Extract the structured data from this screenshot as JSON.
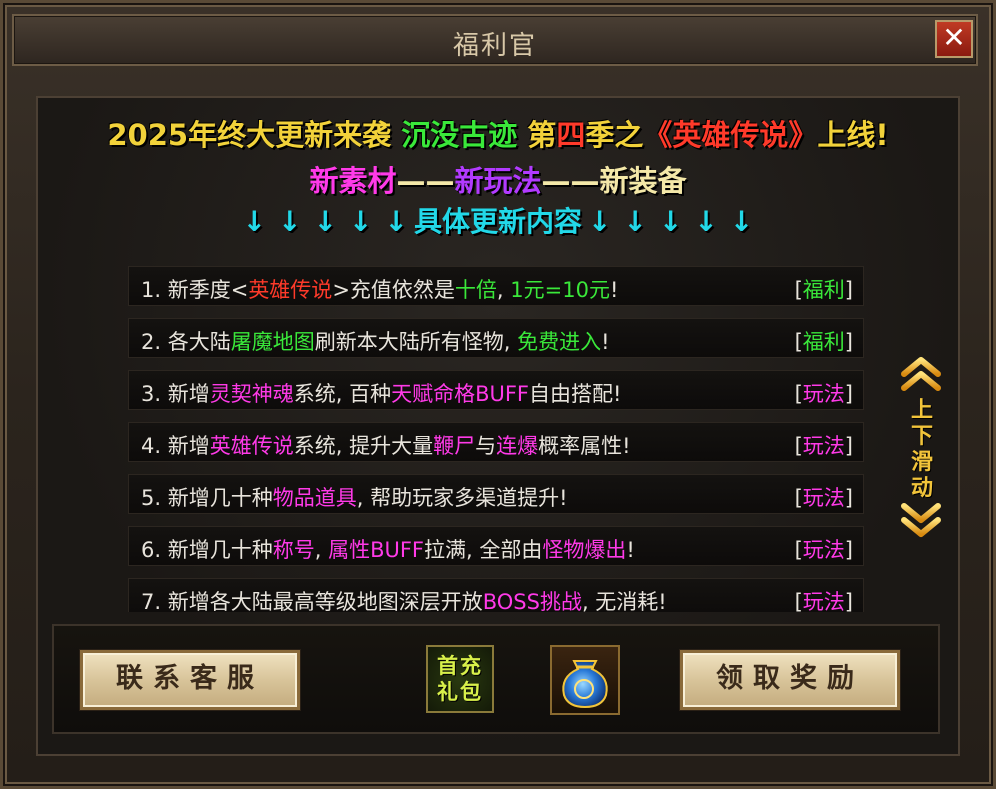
{
  "window": {
    "title": "福利官",
    "close_label": "✕"
  },
  "headline": {
    "part1": "2025年终大更新来袭",
    "part2": "沉没古迹",
    "part3": "第",
    "part4": "四",
    "part5": "季之",
    "part6": "《英雄传说》",
    "part7": "上线!"
  },
  "subline": {
    "item1": "新素材",
    "dash1": "——",
    "item2": "新玩法",
    "dash2": "——",
    "item3": "新装备"
  },
  "details_header": {
    "arrow": "↓",
    "label": "具体更新内容"
  },
  "updates": [
    {
      "segments": [
        {
          "text": "1. 新季度<",
          "color": "white"
        },
        {
          "text": "英雄传说",
          "color": "red"
        },
        {
          "text": ">充值依然是",
          "color": "white"
        },
        {
          "text": "十倍",
          "color": "green"
        },
        {
          "text": ", ",
          "color": "white"
        },
        {
          "text": "1元=10元",
          "color": "green"
        },
        {
          "text": "!",
          "color": "white"
        }
      ],
      "tag": "福利",
      "tag_color": "green"
    },
    {
      "segments": [
        {
          "text": "2. 各大陆",
          "color": "white"
        },
        {
          "text": "屠魔地图",
          "color": "green"
        },
        {
          "text": "刷新本大陆所有怪物, ",
          "color": "white"
        },
        {
          "text": "免费进入",
          "color": "green"
        },
        {
          "text": "!",
          "color": "white"
        }
      ],
      "tag": "福利",
      "tag_color": "green"
    },
    {
      "segments": [
        {
          "text": "3. 新增",
          "color": "white"
        },
        {
          "text": "灵契神魂",
          "color": "magenta"
        },
        {
          "text": "系统, 百种",
          "color": "white"
        },
        {
          "text": "天赋命格BUFF",
          "color": "magenta"
        },
        {
          "text": "自由搭配!",
          "color": "white"
        }
      ],
      "tag": "玩法",
      "tag_color": "magenta"
    },
    {
      "segments": [
        {
          "text": "4. 新增",
          "color": "white"
        },
        {
          "text": "英雄传说",
          "color": "magenta"
        },
        {
          "text": "系统, 提升大量",
          "color": "white"
        },
        {
          "text": "鞭尸",
          "color": "magenta"
        },
        {
          "text": "与",
          "color": "white"
        },
        {
          "text": "连爆",
          "color": "magenta"
        },
        {
          "text": "概率属性!",
          "color": "white"
        }
      ],
      "tag": "玩法",
      "tag_color": "magenta"
    },
    {
      "segments": [
        {
          "text": "5. 新增几十种",
          "color": "white"
        },
        {
          "text": "物品道具",
          "color": "magenta"
        },
        {
          "text": ", 帮助玩家多渠道提升!",
          "color": "white"
        }
      ],
      "tag": "玩法",
      "tag_color": "magenta"
    },
    {
      "segments": [
        {
          "text": "6. 新增几十种",
          "color": "white"
        },
        {
          "text": "称号",
          "color": "magenta"
        },
        {
          "text": ", ",
          "color": "white"
        },
        {
          "text": "属性BUFF",
          "color": "magenta"
        },
        {
          "text": "拉满, 全部由",
          "color": "white"
        },
        {
          "text": "怪物爆出",
          "color": "magenta"
        },
        {
          "text": "!",
          "color": "white"
        }
      ],
      "tag": "玩法",
      "tag_color": "magenta"
    },
    {
      "segments": [
        {
          "text": "7. 新增各大陆最高等级地图深层开放",
          "color": "white"
        },
        {
          "text": "BOSS挑战",
          "color": "magenta"
        },
        {
          "text": ", 无消耗!",
          "color": "white"
        }
      ],
      "tag": "玩法",
      "tag_color": "magenta"
    }
  ],
  "scroll_hint": {
    "text": "上下滑动",
    "icon": "double-chevron-icon"
  },
  "buttons": {
    "contact_support": "联系客服",
    "claim_reward": "领取奖励",
    "first_recharge_gift": "首充礼包"
  },
  "colors": {
    "white": "#e8e4dc",
    "red": "#ff3a2a",
    "green": "#3ae83a",
    "magenta": "#ff3ae8",
    "yellow": "#f2d23a",
    "cyan": "#22d8e8"
  }
}
